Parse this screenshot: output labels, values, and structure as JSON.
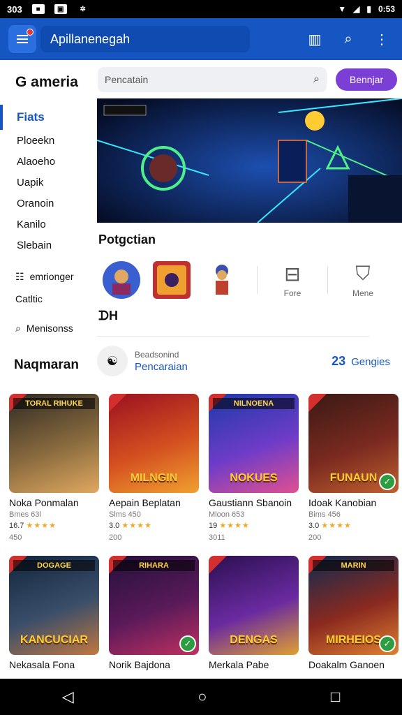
{
  "status": {
    "left_text": "303",
    "time": "0:53",
    "icons": [
      "message-icon",
      "notification-icon",
      "gear-icon",
      "wifi-icon",
      "signal-icon",
      "battery-icon"
    ]
  },
  "appbar": {
    "title": "Apillanenegah",
    "icons": [
      "menu-icon",
      "book-icon",
      "search-icon",
      "more-vert-icon"
    ]
  },
  "sidebar": {
    "brand": "G ameria",
    "active": "Fiats",
    "items": [
      "Ploeekn",
      "Alaoeho",
      "Uapik",
      "Oranoin",
      "Kanilo",
      "Slebain"
    ],
    "sub_items": [
      {
        "icon": "list-icon",
        "label": "emrionger"
      },
      {
        "icon": "none",
        "label": "Catltic"
      },
      {
        "icon": "search-icon",
        "label": "Menisonss"
      }
    ],
    "section": "Naqmaran"
  },
  "search": {
    "placeholder": "Pencatain",
    "button_label": "Bennjar"
  },
  "categories": {
    "title": "Potgctian",
    "items": [
      {
        "label": "",
        "icon": "avatar-hero-1"
      },
      {
        "label": "",
        "icon": "avatar-hero-2"
      },
      {
        "label": "",
        "icon": "avatar-hero-3"
      },
      {
        "label": "Fore",
        "icon": "inbox-icon"
      },
      {
        "label": "Mene",
        "icon": "tshirt-icon"
      }
    ],
    "mini_label": "ᗪH"
  },
  "featured": {
    "line1": "Beadsonind",
    "line2": "Pencaraian",
    "count": "23",
    "count_label": "Gengies"
  },
  "games_row1": [
    {
      "tag": "TORAL RIHUKE",
      "big": "",
      "name": "Noka Ponmalan",
      "meta": "Bmes 63l",
      "rating": "16.7",
      "dl": "450",
      "badge": false,
      "colors": [
        "#2e2a24",
        "#8a6b3f",
        "#e0a860"
      ]
    },
    {
      "tag": "",
      "big": "MILNGIN",
      "name": "Aepain Beplatan",
      "meta": "Slms 450",
      "rating": "3.0",
      "dl": "200",
      "badge": false,
      "colors": [
        "#9a1020",
        "#d45020",
        "#f0a030"
      ]
    },
    {
      "tag": "NILNOENA",
      "big": "NOKUES",
      "name": "Gaustiann Sbanoin",
      "meta": "Mloon 653",
      "rating": "19",
      "dl": "3011",
      "badge": false,
      "colors": [
        "#1d3aa8",
        "#6e3cc8",
        "#e05090"
      ]
    },
    {
      "tag": "",
      "big": "FUNAUN",
      "name": "Idoak Kanobian",
      "meta": "Bims 456",
      "rating": "3.0",
      "dl": "200",
      "badge": true,
      "colors": [
        "#3a1a14",
        "#7a2a20",
        "#c06030"
      ]
    }
  ],
  "games_row2": [
    {
      "tag": "DOGAGE",
      "big": "KANCUCIAR",
      "name": "Nekasala Fona",
      "meta": "",
      "rating": "",
      "dl": "",
      "badge": false,
      "colors": [
        "#12253d",
        "#3a4e6a",
        "#c07840"
      ]
    },
    {
      "tag": "RIHARA",
      "big": "",
      "name": "Norik Bajdona",
      "meta": "",
      "rating": "",
      "dl": "",
      "badge": true,
      "colors": [
        "#24103a",
        "#5a1a5a",
        "#c03060"
      ]
    },
    {
      "tag": "",
      "big": "DENGAS",
      "name": "Merkala Pabe",
      "meta": "",
      "rating": "",
      "dl": "",
      "badge": false,
      "colors": [
        "#2a1050",
        "#6a2aa0",
        "#e0a030"
      ]
    },
    {
      "tag": "MARIN",
      "big": "MIRHEIOS",
      "name": "Doakalm Ganoen",
      "meta": "",
      "rating": "",
      "dl": "",
      "badge": true,
      "colors": [
        "#102a50",
        "#8a2a20",
        "#e08030"
      ]
    }
  ],
  "navbar": {
    "icons": [
      "back-icon",
      "home-icon",
      "recents-icon"
    ]
  }
}
